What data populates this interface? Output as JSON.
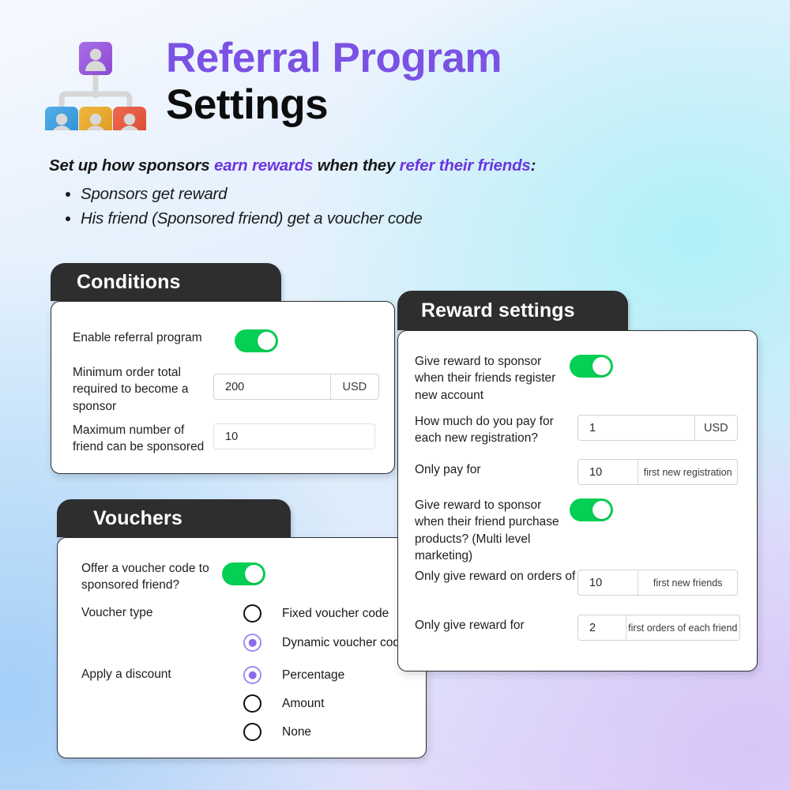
{
  "header": {
    "icon": "org-hierarchy-people-icon",
    "title_line1": "Referral Program",
    "title_line2": "Settings",
    "title_color": "#7b52e3"
  },
  "intro": {
    "lead_part1": "Set up how sponsors ",
    "lead_highlight1": "earn rewards",
    "lead_part2": " when they ",
    "lead_highlight2": "refer their friends",
    "lead_part3": ":",
    "bullets": [
      "Sponsors get reward",
      "His friend (Sponsored friend) get a voucher code"
    ]
  },
  "colors": {
    "accent_purple": "#7b52e3",
    "toggle_green": "#05cf54",
    "radio_purple": "#a38bef",
    "card_header_dark": "#2e2e2e"
  },
  "cards": {
    "conditions": {
      "title": "Conditions",
      "rows": [
        {
          "label": "Enable referral program",
          "control": "toggle",
          "state": "on"
        },
        {
          "label": "Minimum order total required to become a sponsor",
          "control": "field",
          "value": "200",
          "suffix": "USD"
        },
        {
          "label": "Maximum number of friend can be sponsored",
          "control": "field",
          "value": "10",
          "suffix": ""
        }
      ]
    },
    "reward_settings": {
      "title": "Reward settings",
      "rows": [
        {
          "label": "Give reward to sponsor when their friends register new account",
          "control": "toggle",
          "state": "on"
        },
        {
          "label": "How much do you pay for each new registration?",
          "control": "field",
          "value": "1",
          "suffix": "USD"
        },
        {
          "label": "Only pay for",
          "control": "field",
          "value": "10",
          "suffix": "first new registration"
        },
        {
          "label": "Give reward to sponsor when their friend purchase products? (Multi level marketing)",
          "control": "toggle",
          "state": "on"
        },
        {
          "label": "Only give reward on orders of",
          "control": "field",
          "value": "10",
          "suffix": "first new friends"
        },
        {
          "label": "Only give reward for",
          "control": "field",
          "value": "2",
          "suffix": "first orders of each friend"
        }
      ]
    },
    "vouchers": {
      "title": "Vouchers",
      "rows": [
        {
          "label": "Offer a voucher code to sponsored friend?",
          "control": "toggle",
          "state": "on"
        },
        {
          "label": "Voucher type",
          "control": "radio-group",
          "options": [
            {
              "label": "Fixed voucher code",
              "selected": false
            },
            {
              "label": "Dynamic voucher code",
              "selected": true
            }
          ]
        },
        {
          "label": "Apply a discount",
          "control": "radio-group",
          "options": [
            {
              "label": "Percentage",
              "selected": true
            },
            {
              "label": "Amount",
              "selected": false
            },
            {
              "label": "None",
              "selected": false
            }
          ]
        }
      ]
    }
  }
}
